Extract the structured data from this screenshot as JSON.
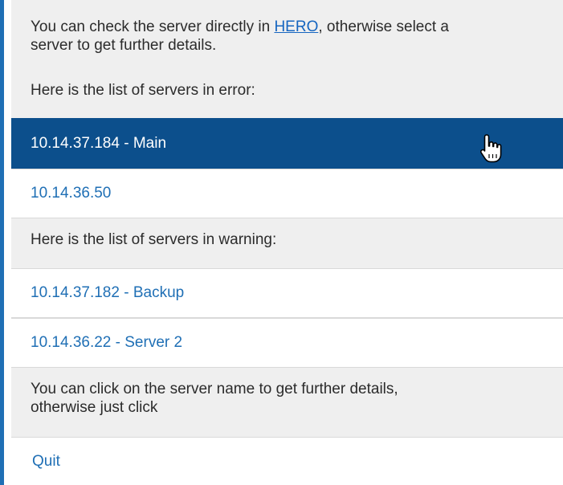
{
  "intro": {
    "text_before_link": "You can check the server directly in ",
    "link_label": "HERO",
    "text_after_link": ", otherwise select a",
    "line2": "server to get further details."
  },
  "error_heading": "Here is the list of servers in error:",
  "error_servers": [
    {
      "label": "10.14.37.184 - Main",
      "selected": true
    },
    {
      "label": "10.14.36.50",
      "selected": false
    }
  ],
  "warning_heading": "Here is the list of servers in warning:",
  "warning_servers": [
    {
      "label": "10.14.37.182 - Backup"
    },
    {
      "label": "10.14.36.22 - Server 2"
    }
  ],
  "footer_message": {
    "line1": "You can click on the server name to get further details,",
    "line2": "otherwise just click"
  },
  "quit_label": "Quit",
  "colors": {
    "accent": "#1f6fb5",
    "selected_bg": "#0c4f8c",
    "panel_bg": "#efefef",
    "link": "#1565c0"
  },
  "cursor_icon": "hand-pointer-icon"
}
